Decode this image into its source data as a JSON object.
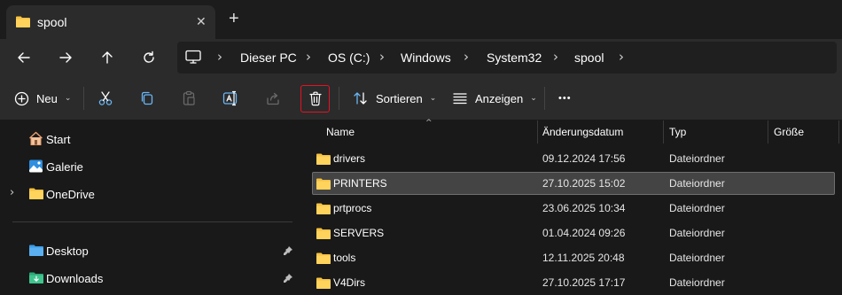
{
  "tab": {
    "title": "spool",
    "close": "✕",
    "new": "+"
  },
  "breadcrumb": [
    "Dieser PC",
    "OS (C:)",
    "Windows",
    "System32",
    "spool"
  ],
  "toolbar": {
    "new_label": "Neu",
    "sort_label": "Sortieren",
    "view_label": "Anzeigen",
    "more": "•••"
  },
  "sidebar": {
    "items": [
      {
        "label": "Start",
        "icon": "home-icon"
      },
      {
        "label": "Galerie",
        "icon": "gallery-icon"
      },
      {
        "label": "OneDrive",
        "icon": "folder-icon",
        "expandable": true
      },
      {
        "label": "Desktop",
        "icon": "desktop-folder-icon",
        "pinned": true
      },
      {
        "label": "Downloads",
        "icon": "downloads-folder-icon",
        "pinned": true
      }
    ]
  },
  "columns": [
    "Name",
    "Änderungsdatum",
    "Typ",
    "Größe"
  ],
  "files": [
    {
      "name": "drivers",
      "date": "09.12.2024 17:56",
      "type": "Dateiordner"
    },
    {
      "name": "PRINTERS",
      "date": "27.10.2025 15:02",
      "type": "Dateiordner",
      "selected": true
    },
    {
      "name": "prtprocs",
      "date": "23.06.2025 10:34",
      "type": "Dateiordner"
    },
    {
      "name": "SERVERS",
      "date": "01.04.2024 09:26",
      "type": "Dateiordner"
    },
    {
      "name": "tools",
      "date": "12.11.2025 20:48",
      "type": "Dateiordner"
    },
    {
      "name": "V4Dirs",
      "date": "27.10.2025 17:17",
      "type": "Dateiordner"
    }
  ],
  "colors": {
    "folder": "#f5c242",
    "accent": "#4fb1ff",
    "delete_highlight": "#e81123",
    "selected_row": "#444444"
  }
}
